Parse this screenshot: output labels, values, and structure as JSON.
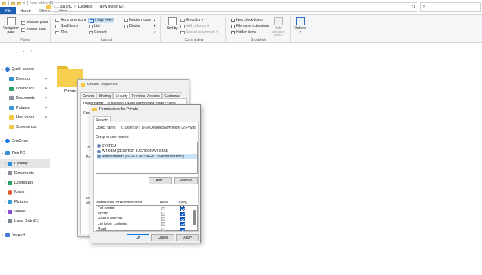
{
  "window": {
    "title": "New folder (2)"
  },
  "ribbon_tabs": [
    "File",
    "Home",
    "Share",
    "View"
  ],
  "ribbon": {
    "panes": {
      "navigation_pane": "Navigation pane",
      "preview_pane": "Preview pane",
      "details_pane": "Details pane",
      "label": "Panes"
    },
    "layout": {
      "label": "Layout",
      "items": [
        "Extra large icons",
        "Large icons",
        "Medium icons",
        "Small icons",
        "List",
        "Details",
        "Tiles",
        "Content"
      ]
    },
    "current_view": {
      "label": "Current view",
      "sort_by": "Sort by",
      "group_by": "Group by",
      "add_columns": "Add columns",
      "size_columns": "Size all columns to fit"
    },
    "show_hide": {
      "label": "Show/hide",
      "item_check_boxes": "Item check boxes",
      "file_name_extensions": "File name extensions",
      "hidden_items": "Hidden items",
      "hide_selected": "Hide selected items"
    },
    "options": "Options"
  },
  "address": {
    "crumbs": [
      "This PC",
      "Desktop",
      "New folder (2)"
    ]
  },
  "nav": {
    "items": [
      {
        "label": "Quick access",
        "pinned": false
      },
      {
        "label": "Desktop",
        "pinned": true
      },
      {
        "label": "Downloads",
        "pinned": true
      },
      {
        "label": "Documents",
        "pinned": true
      },
      {
        "label": "Pictures",
        "pinned": true
      },
      {
        "label": "New folder",
        "pinned": true
      },
      {
        "label": "Screenshots",
        "pinned": false
      },
      {
        "label": "OneDrive",
        "pinned": false
      },
      {
        "label": "This PC",
        "pinned": false
      },
      {
        "label": "Desktop",
        "pinned": false
      },
      {
        "label": "Documents",
        "pinned": false
      },
      {
        "label": "Downloads",
        "pinned": false
      },
      {
        "label": "Music",
        "pinned": false
      },
      {
        "label": "Pictures",
        "pinned": false
      },
      {
        "label": "Videos",
        "pinned": false
      },
      {
        "label": "Local Disk (C:)",
        "pinned": false
      },
      {
        "label": "Network",
        "pinned": false
      }
    ]
  },
  "content": {
    "folder_name": "Private"
  },
  "properties_dialog": {
    "title": "Private Properties",
    "tabs": [
      "General",
      "Sharing",
      "Security",
      "Previous Versions",
      "Customize"
    ],
    "object_fragment": "Object name:   C:\\Users\\WT DEM\\Desktop\\New folder (2)\\Priv",
    "frag_group": "Grou",
    "frag_to": "To",
    "frag_pe": "Pe",
    "frag_fo": "Fo",
    "frag_cl": "cli"
  },
  "permissions_dialog": {
    "title": "Permissions for Private",
    "tab": "Security",
    "object_label": "Object name:",
    "object_path": "C:\\Users\\WT DEM\\Desktop\\New folder (2)\\Privat",
    "group_label": "Group or user names:",
    "users": [
      "SYSTEM",
      "WT DEM (DESKTOP-3UGRCD5\\WT DEM)",
      "Administrators (DESKTOP-3UGRCD5\\Administrators)"
    ],
    "add_button": "Add...",
    "remove_button": "Remove",
    "perm_header": "Permissions for Administrators",
    "allow_header": "Allow",
    "deny_header": "Deny",
    "permissions": [
      {
        "name": "Full control",
        "allow": false,
        "deny": true
      },
      {
        "name": "Modify",
        "allow": false,
        "deny": true
      },
      {
        "name": "Read & execute",
        "allow": false,
        "deny": true
      },
      {
        "name": "List folder contents",
        "allow": false,
        "deny": true
      },
      {
        "name": "Read",
        "allow": false,
        "deny": true
      }
    ],
    "ok_button": "OK",
    "cancel_button": "Cancel",
    "apply_button": "Apply"
  }
}
